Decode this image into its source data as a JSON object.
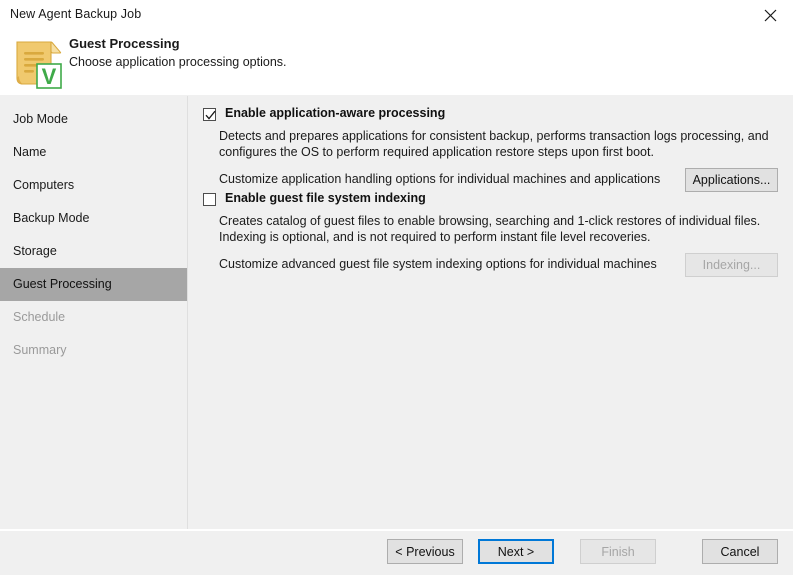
{
  "window": {
    "title": "New Agent Backup Job",
    "close_icon": "close-icon"
  },
  "header": {
    "icon": "document-veeam-icon",
    "title": "Guest Processing",
    "subtitle": "Choose application processing options."
  },
  "sidebar": {
    "items": [
      {
        "label": "Job Mode",
        "state": "normal"
      },
      {
        "label": "Name",
        "state": "normal"
      },
      {
        "label": "Computers",
        "state": "normal"
      },
      {
        "label": "Backup Mode",
        "state": "normal"
      },
      {
        "label": "Storage",
        "state": "normal"
      },
      {
        "label": "Guest Processing",
        "state": "active"
      },
      {
        "label": "Schedule",
        "state": "disabled"
      },
      {
        "label": "Summary",
        "state": "disabled"
      }
    ]
  },
  "main": {
    "application_aware": {
      "checkbox_label": "Enable application-aware processing",
      "checked": true,
      "description_line1": "Detects and prepares applications for consistent backup, performs transaction logs processing, and",
      "description_line2": "configures the OS to perform required application restore steps upon first boot.",
      "customize_text": "Customize application handling options for individual machines and applications",
      "button_label": "Applications...",
      "button_enabled": true
    },
    "guest_indexing": {
      "checkbox_label": "Enable guest file system indexing",
      "checked": false,
      "description_line1": "Creates catalog of guest files to enable browsing, searching and 1-click restores of individual files.",
      "description_line2": "Indexing is optional, and is not required to perform instant file level recoveries.",
      "customize_text": "Customize advanced guest file system indexing options for individual machines",
      "button_label": "Indexing...",
      "button_enabled": false
    }
  },
  "footer": {
    "previous_label": "< Previous",
    "next_label": "Next >",
    "finish_label": "Finish",
    "cancel_label": "Cancel",
    "finish_enabled": false,
    "default_button": "next"
  },
  "colors": {
    "background": "#f0f0f0",
    "header_background": "#ffffff",
    "active_nav": "#a6a6a6",
    "focus_border": "#0078d7",
    "disabled_text": "#9a9a9a",
    "icon_paper": "#eec96a",
    "icon_veeam_green": "#3faa49"
  }
}
